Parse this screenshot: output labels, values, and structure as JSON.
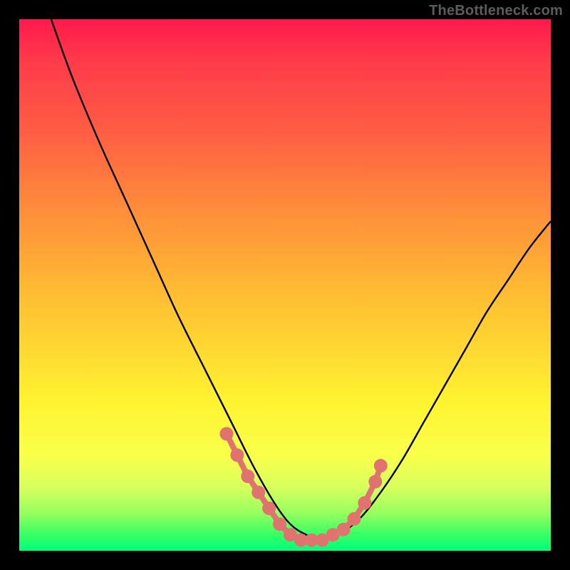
{
  "watermark": "TheBottleneck.com",
  "chart_data": {
    "type": "line",
    "title": "",
    "xlabel": "",
    "ylabel": "",
    "xlim": [
      0,
      100
    ],
    "ylim": [
      0,
      100
    ],
    "grid": false,
    "legend": false,
    "background": "vertical-gradient red→green",
    "series": [
      {
        "name": "bottleneck-curve",
        "color": "#000000",
        "x": [
          6,
          10,
          15,
          20,
          25,
          30,
          35,
          40,
          44,
          48,
          51,
          54,
          57,
          60,
          64,
          68,
          72,
          76,
          80,
          84,
          88,
          92,
          96,
          100
        ],
        "y": [
          100,
          89,
          77,
          66,
          55,
          44,
          34,
          24,
          16,
          9,
          5,
          3,
          2,
          3,
          6,
          11,
          17,
          24,
          31,
          38,
          45,
          51,
          57,
          62
        ]
      }
    ],
    "markers": {
      "name": "highlighted-points",
      "color": "#e0736f",
      "style": "linked-dots",
      "x": [
        39,
        41,
        43,
        45,
        47,
        49,
        51,
        53,
        55,
        57,
        59,
        61,
        63,
        65,
        67,
        68
      ],
      "y": [
        22,
        18,
        14,
        11,
        8,
        5,
        3,
        2,
        2,
        2,
        3,
        4,
        6,
        9,
        13,
        16
      ]
    }
  }
}
